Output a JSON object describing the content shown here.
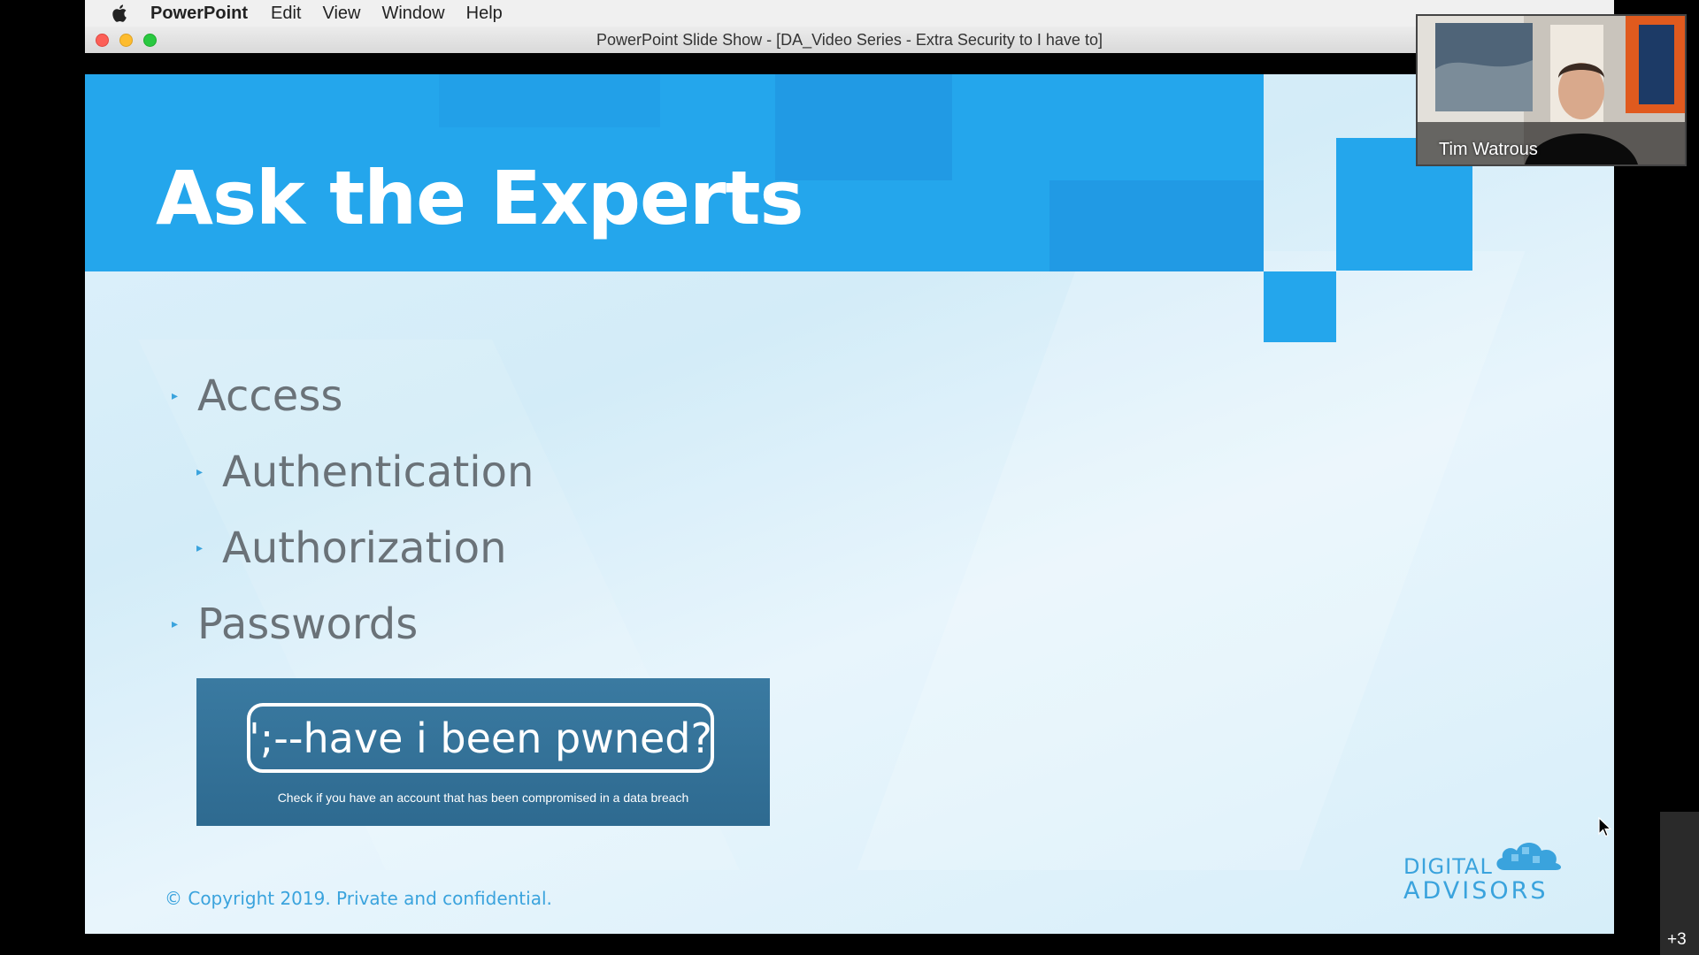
{
  "menubar": {
    "app_name": "PowerPoint",
    "items": [
      "Edit",
      "View",
      "Window",
      "Help"
    ]
  },
  "window": {
    "title": "PowerPoint Slide Show - [DA_Video Series - Extra Security to I have to]"
  },
  "slide": {
    "title": "Ask the Experts",
    "bullets": [
      {
        "level": 1,
        "text": "Access"
      },
      {
        "level": 2,
        "text": "Authentication"
      },
      {
        "level": 2,
        "text": "Authorization"
      },
      {
        "level": 1,
        "text": "Passwords"
      }
    ],
    "hibp": {
      "headline": "';--have i been pwned?",
      "tagline": "Check if you have an account that has been compromised in a data breach"
    },
    "copyright": "© Copyright 2019. Private and confidential.",
    "logo": {
      "line1": "DIGITAL",
      "line2": "ADVISORS"
    }
  },
  "video": {
    "participant_name": "Tim Watrous",
    "more_participants": "+3"
  },
  "colors": {
    "accent_blue": "#24a6ec",
    "text_grey": "#6a7278",
    "hibp_blue": "#2f6d94"
  },
  "icons": {
    "apple": "apple-logo-icon",
    "bullet": "triangle-bullet-icon",
    "cursor": "mouse-pointer-icon"
  }
}
